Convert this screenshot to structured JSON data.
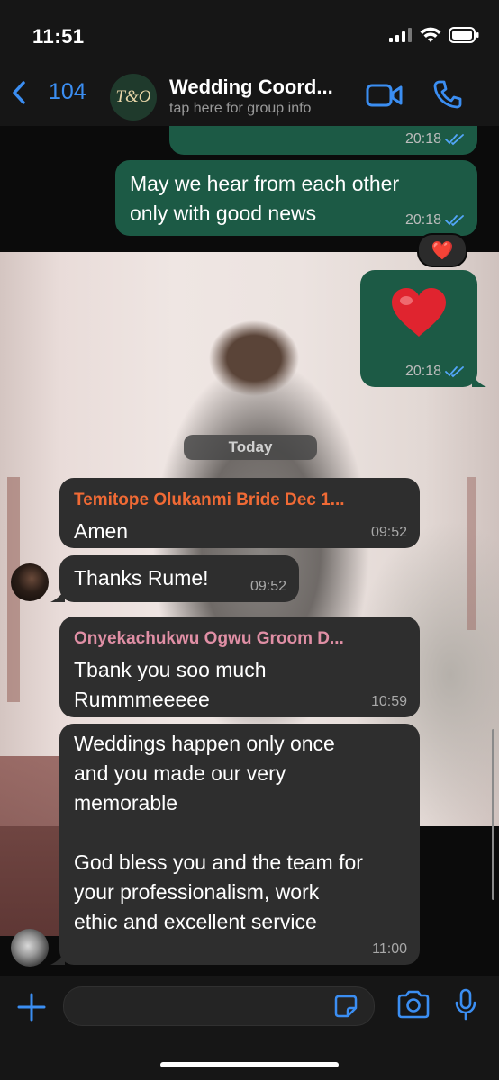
{
  "status": {
    "time": "11:51"
  },
  "header": {
    "back_count": "104",
    "group_initials": "T&O",
    "title": "Wedding Coord...",
    "subtitle": "tap here for group info"
  },
  "messages": [
    {
      "text": "",
      "time": "20:18"
    },
    {
      "text_line1": "May we hear from each other",
      "text_line2": "only with good news",
      "time": "20:18",
      "reaction": "❤️"
    },
    {
      "text": "❤️",
      "time": "20:18"
    },
    {
      "day": "Today"
    },
    {
      "sender": "Temitope Olukanmi Bride Dec 1...",
      "text": "Amen",
      "time": "09:52",
      "sender_color": "#f06a35"
    },
    {
      "text": "Thanks Rume!",
      "time": "09:52"
    },
    {
      "sender": "Onyekachukwu  Ogwu Groom D...",
      "text_line1": "Tbank you soo much",
      "text_line2": "Rummmeeeee",
      "time": "10:59",
      "sender_color": "#e08fa5"
    },
    {
      "lines": [
        "Weddings happen only once",
        "and you made our very",
        "memorable",
        "",
        "God bless you and the team for",
        "your professionalism, work",
        "ethic and excellent service"
      ],
      "time": "11:00"
    }
  ],
  "colors": {
    "accent": "#3b8ef2",
    "outgoing_bubble": "#1c5a45",
    "incoming_bubble": "#2e2e2e",
    "read_ticks": "#53a6fa"
  }
}
